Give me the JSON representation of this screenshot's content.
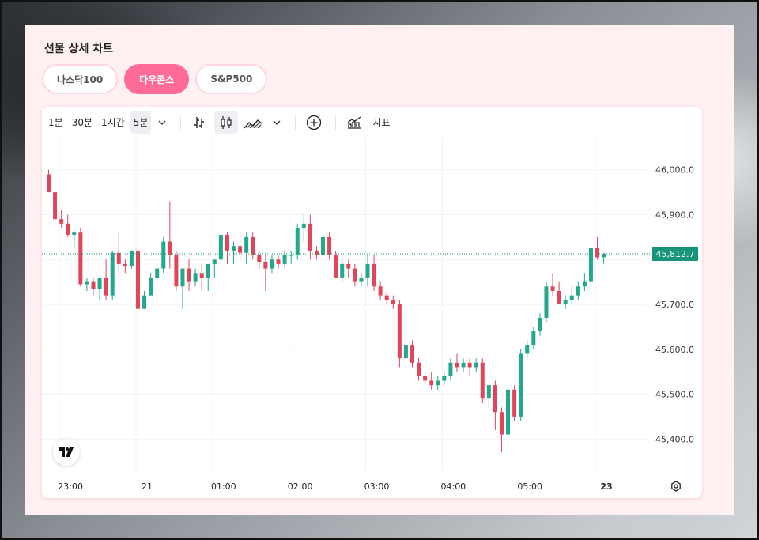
{
  "page": {
    "title": "선물 상세 차트"
  },
  "tabs": [
    {
      "label": "나스닥100",
      "active": false
    },
    {
      "label": "다우존스",
      "active": true
    },
    {
      "label": "S&P500",
      "active": false
    }
  ],
  "toolbar": {
    "intervals": [
      "1분",
      "30분",
      "1시간",
      "5분"
    ],
    "selected_interval": "5분",
    "indicators_label": "지표",
    "icons": [
      "chevron-down-icon",
      "bar-chart-icon",
      "candlestick-icon",
      "area-chart-icon",
      "chevron-down-icon",
      "plus-circle-icon",
      "indicators-icon"
    ]
  },
  "colors": {
    "up": "#22a88a",
    "down": "#e0455c",
    "accent": "#ff6b98",
    "price_tag": "#16957a"
  },
  "chart_data": {
    "type": "candlestick",
    "current_price": 45812.7,
    "current_price_label": "45,812.7",
    "ylim": [
      45330,
      46070
    ],
    "y_ticks": [
      {
        "value": 46000,
        "label": "46,000.0"
      },
      {
        "value": 45900,
        "label": "45,900.0"
      },
      {
        "value": 45700,
        "label": "45,700.0"
      },
      {
        "value": 45600,
        "label": "45,600.0"
      },
      {
        "value": 45500,
        "label": "45,500.0"
      },
      {
        "value": 45400,
        "label": "45,400.0"
      }
    ],
    "x_ticks": [
      {
        "index": 2,
        "label": "23:00",
        "bold": false
      },
      {
        "index": 14,
        "label": "21",
        "bold": false
      },
      {
        "index": 26,
        "label": "01:00",
        "bold": false
      },
      {
        "index": 38,
        "label": "02:00",
        "bold": false
      },
      {
        "index": 50,
        "label": "03:00",
        "bold": false
      },
      {
        "index": 62,
        "label": "04:00",
        "bold": false
      },
      {
        "index": 74,
        "label": "05:00",
        "bold": false
      },
      {
        "index": 86,
        "label": "23",
        "bold": true
      }
    ],
    "candles": [
      [
        45990,
        46000,
        45950,
        45950
      ],
      [
        45950,
        45960,
        45880,
        45890
      ],
      [
        45890,
        45910,
        45870,
        45880
      ],
      [
        45880,
        45900,
        45850,
        45855
      ],
      [
        45855,
        45865,
        45825,
        45860
      ],
      [
        45860,
        45870,
        45740,
        45745
      ],
      [
        45745,
        45760,
        45730,
        45750
      ],
      [
        45750,
        45760,
        45720,
        45735
      ],
      [
        45735,
        45760,
        45710,
        45760
      ],
      [
        45760,
        45800,
        45710,
        45720
      ],
      [
        45720,
        45820,
        45710,
        45815
      ],
      [
        45815,
        45860,
        45770,
        45790
      ],
      [
        45790,
        45800,
        45770,
        45785
      ],
      [
        45785,
        45820,
        45780,
        45820
      ],
      [
        45820,
        45830,
        45690,
        45690
      ],
      [
        45690,
        45730,
        45690,
        45720
      ],
      [
        45720,
        45770,
        45720,
        45760
      ],
      [
        45760,
        45790,
        45750,
        45780
      ],
      [
        45780,
        45850,
        45770,
        45840
      ],
      [
        45840,
        45930,
        45780,
        45810
      ],
      [
        45810,
        45820,
        45730,
        45740
      ],
      [
        45740,
        45780,
        45690,
        45780
      ],
      [
        45780,
        45800,
        45730,
        45750
      ],
      [
        45750,
        45780,
        45740,
        45770
      ],
      [
        45770,
        45790,
        45730,
        45760
      ],
      [
        45760,
        45790,
        45730,
        45790
      ],
      [
        45790,
        45800,
        45760,
        45800
      ],
      [
        45800,
        45860,
        45790,
        45855
      ],
      [
        45855,
        45860,
        45790,
        45820
      ],
      [
        45820,
        45840,
        45790,
        45830
      ],
      [
        45830,
        45860,
        45800,
        45815
      ],
      [
        45815,
        45860,
        45790,
        45850
      ],
      [
        45850,
        45860,
        45800,
        45810
      ],
      [
        45810,
        45820,
        45780,
        45795
      ],
      [
        45795,
        45810,
        45730,
        45780
      ],
      [
        45780,
        45810,
        45770,
        45800
      ],
      [
        45800,
        45810,
        45780,
        45790
      ],
      [
        45790,
        45820,
        45780,
        45810
      ],
      [
        45810,
        45820,
        45790,
        45810
      ],
      [
        45810,
        45880,
        45800,
        45870
      ],
      [
        45870,
        45900,
        45840,
        45880
      ],
      [
        45880,
        45900,
        45800,
        45820
      ],
      [
        45820,
        45830,
        45800,
        45810
      ],
      [
        45810,
        45860,
        45800,
        45850
      ],
      [
        45850,
        45860,
        45800,
        45810
      ],
      [
        45810,
        45820,
        45760,
        45760
      ],
      [
        45760,
        45800,
        45750,
        45790
      ],
      [
        45790,
        45800,
        45760,
        45780
      ],
      [
        45780,
        45790,
        45740,
        45750
      ],
      [
        45750,
        45770,
        45740,
        45760
      ],
      [
        45760,
        45810,
        45740,
        45790
      ],
      [
        45790,
        45810,
        45730,
        45740
      ],
      [
        45740,
        45750,
        45710,
        45720
      ],
      [
        45720,
        45730,
        45700,
        45710
      ],
      [
        45710,
        45720,
        45690,
        45700
      ],
      [
        45700,
        45710,
        45560,
        45580
      ],
      [
        45580,
        45620,
        45570,
        45610
      ],
      [
        45610,
        45620,
        45560,
        45570
      ],
      [
        45570,
        45580,
        45530,
        45540
      ],
      [
        45540,
        45550,
        45520,
        45530
      ],
      [
        45530,
        45550,
        45510,
        45520
      ],
      [
        45520,
        45540,
        45510,
        45530
      ],
      [
        45530,
        45550,
        45520,
        45540
      ],
      [
        45540,
        45580,
        45530,
        45570
      ],
      [
        45570,
        45590,
        45550,
        45560
      ],
      [
        45560,
        45580,
        45550,
        45570
      ],
      [
        45570,
        45580,
        45540,
        45560
      ],
      [
        45560,
        45580,
        45550,
        45570
      ],
      [
        45570,
        45580,
        45480,
        45490
      ],
      [
        45490,
        45520,
        45470,
        45520
      ],
      [
        45520,
        45530,
        45420,
        45460
      ],
      [
        45460,
        45470,
        45370,
        45410
      ],
      [
        45410,
        45520,
        45400,
        45510
      ],
      [
        45510,
        45520,
        45440,
        45450
      ],
      [
        45450,
        45600,
        45440,
        45590
      ],
      [
        45590,
        45620,
        45580,
        45610
      ],
      [
        45610,
        45650,
        45600,
        45640
      ],
      [
        45640,
        45680,
        45630,
        45670
      ],
      [
        45670,
        45750,
        45660,
        45740
      ],
      [
        45740,
        45770,
        45720,
        45730
      ],
      [
        45730,
        45750,
        45700,
        45700
      ],
      [
        45700,
        45720,
        45690,
        45710
      ],
      [
        45710,
        45740,
        45700,
        45720
      ],
      [
        45720,
        45750,
        45710,
        45740
      ],
      [
        45740,
        45770,
        45730,
        45750
      ],
      [
        45750,
        45830,
        45740,
        45825
      ],
      [
        45825,
        45850,
        45800,
        45805
      ],
      [
        45805,
        45815,
        45790,
        45812.7
      ]
    ]
  }
}
